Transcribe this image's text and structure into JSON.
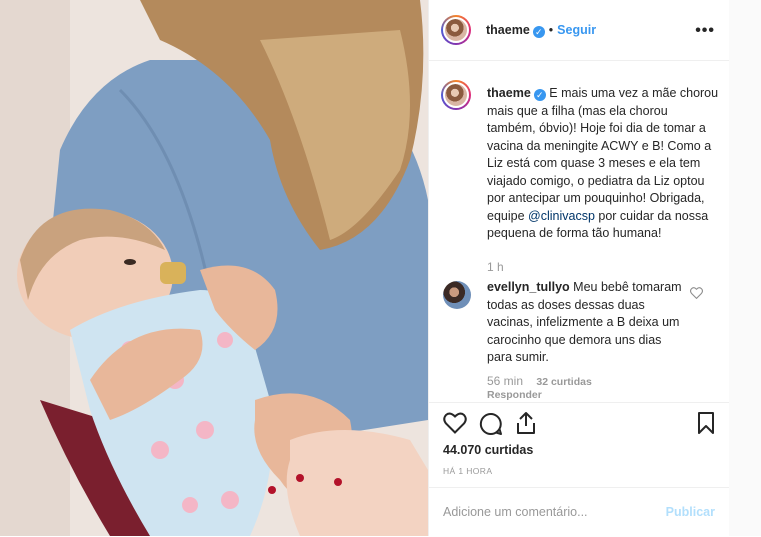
{
  "post": {
    "author": {
      "username": "thaeme",
      "verified": true,
      "follow_label": "Seguir",
      "more_label": "•••"
    },
    "caption": {
      "username": "thaeme",
      "text_before_mention": "E mais uma vez a mãe chorou mais que a filha (mas ela chorou também, óbvio)! Hoje foi dia de tomar a vacina da meningite ACWY e B! Como a Liz está com quase 3 meses e ela tem viajado comigo, o pediatra da Liz optou por antecipar um pouquinho! Obrigada, equipe ",
      "mention": "@clinivacsp",
      "text_after_mention": " por cuidar da nossa pequena de forma tão humana!",
      "time": "1 h"
    },
    "comments": [
      {
        "username": "evellyn_tullyo",
        "text": "Meu bebê tomaram todas as doses dessas duas vacinas, infelizmente a B deixa um carocinho que demora uns dias para sumir.",
        "time": "56 min",
        "likes": "32 curtidas",
        "reply_label": "Responder"
      }
    ],
    "likes_count": "44.070 curtidas",
    "posted_time": "HÁ 1 HORA",
    "comment_box": {
      "placeholder": "Adicione um comentário...",
      "publish_label": "Publicar"
    },
    "icons": {
      "like": "heart-icon",
      "comment": "comment-icon",
      "share": "share-icon",
      "save": "bookmark-icon",
      "comment_like": "heart-icon"
    },
    "colors": {
      "link": "#3897f0",
      "text": "#262626",
      "muted": "#999999",
      "publish_disabled": "#b2dffc"
    }
  }
}
